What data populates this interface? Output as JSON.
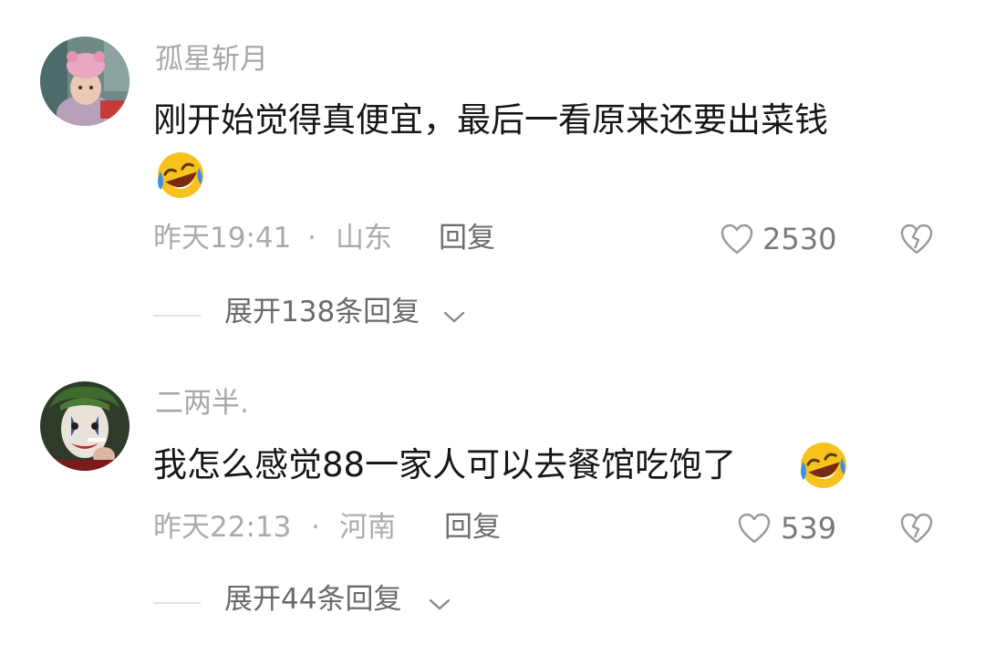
{
  "comments": [
    {
      "username": "孤星斩月",
      "text": "刚开始觉得真便宜，最后一看原来还要出菜钱",
      "time": "昨天19:41",
      "separator": "·",
      "location": "山东",
      "reply_label": "回复",
      "likes": "2530",
      "expand_label": "展开138条回复",
      "emoji": "laughing-crying-emoji",
      "avatar": "child-in-pink-hat-avatar"
    },
    {
      "username": "二两半.",
      "text": "我怎么感觉88一家人可以去餐馆吃饱了",
      "time": "昨天22:13",
      "separator": "·",
      "location": "河南",
      "reply_label": "回复",
      "likes": "539",
      "expand_label": "展开44条回复",
      "emoji": "laughing-crying-emoji",
      "avatar": "joker-face-avatar"
    }
  ],
  "colors": {
    "text": "#161616",
    "meta": "#ababab",
    "username": "#a8a8a8",
    "emoji_yellow": "#f7c21e",
    "emoji_tear": "#3d8fe6"
  }
}
